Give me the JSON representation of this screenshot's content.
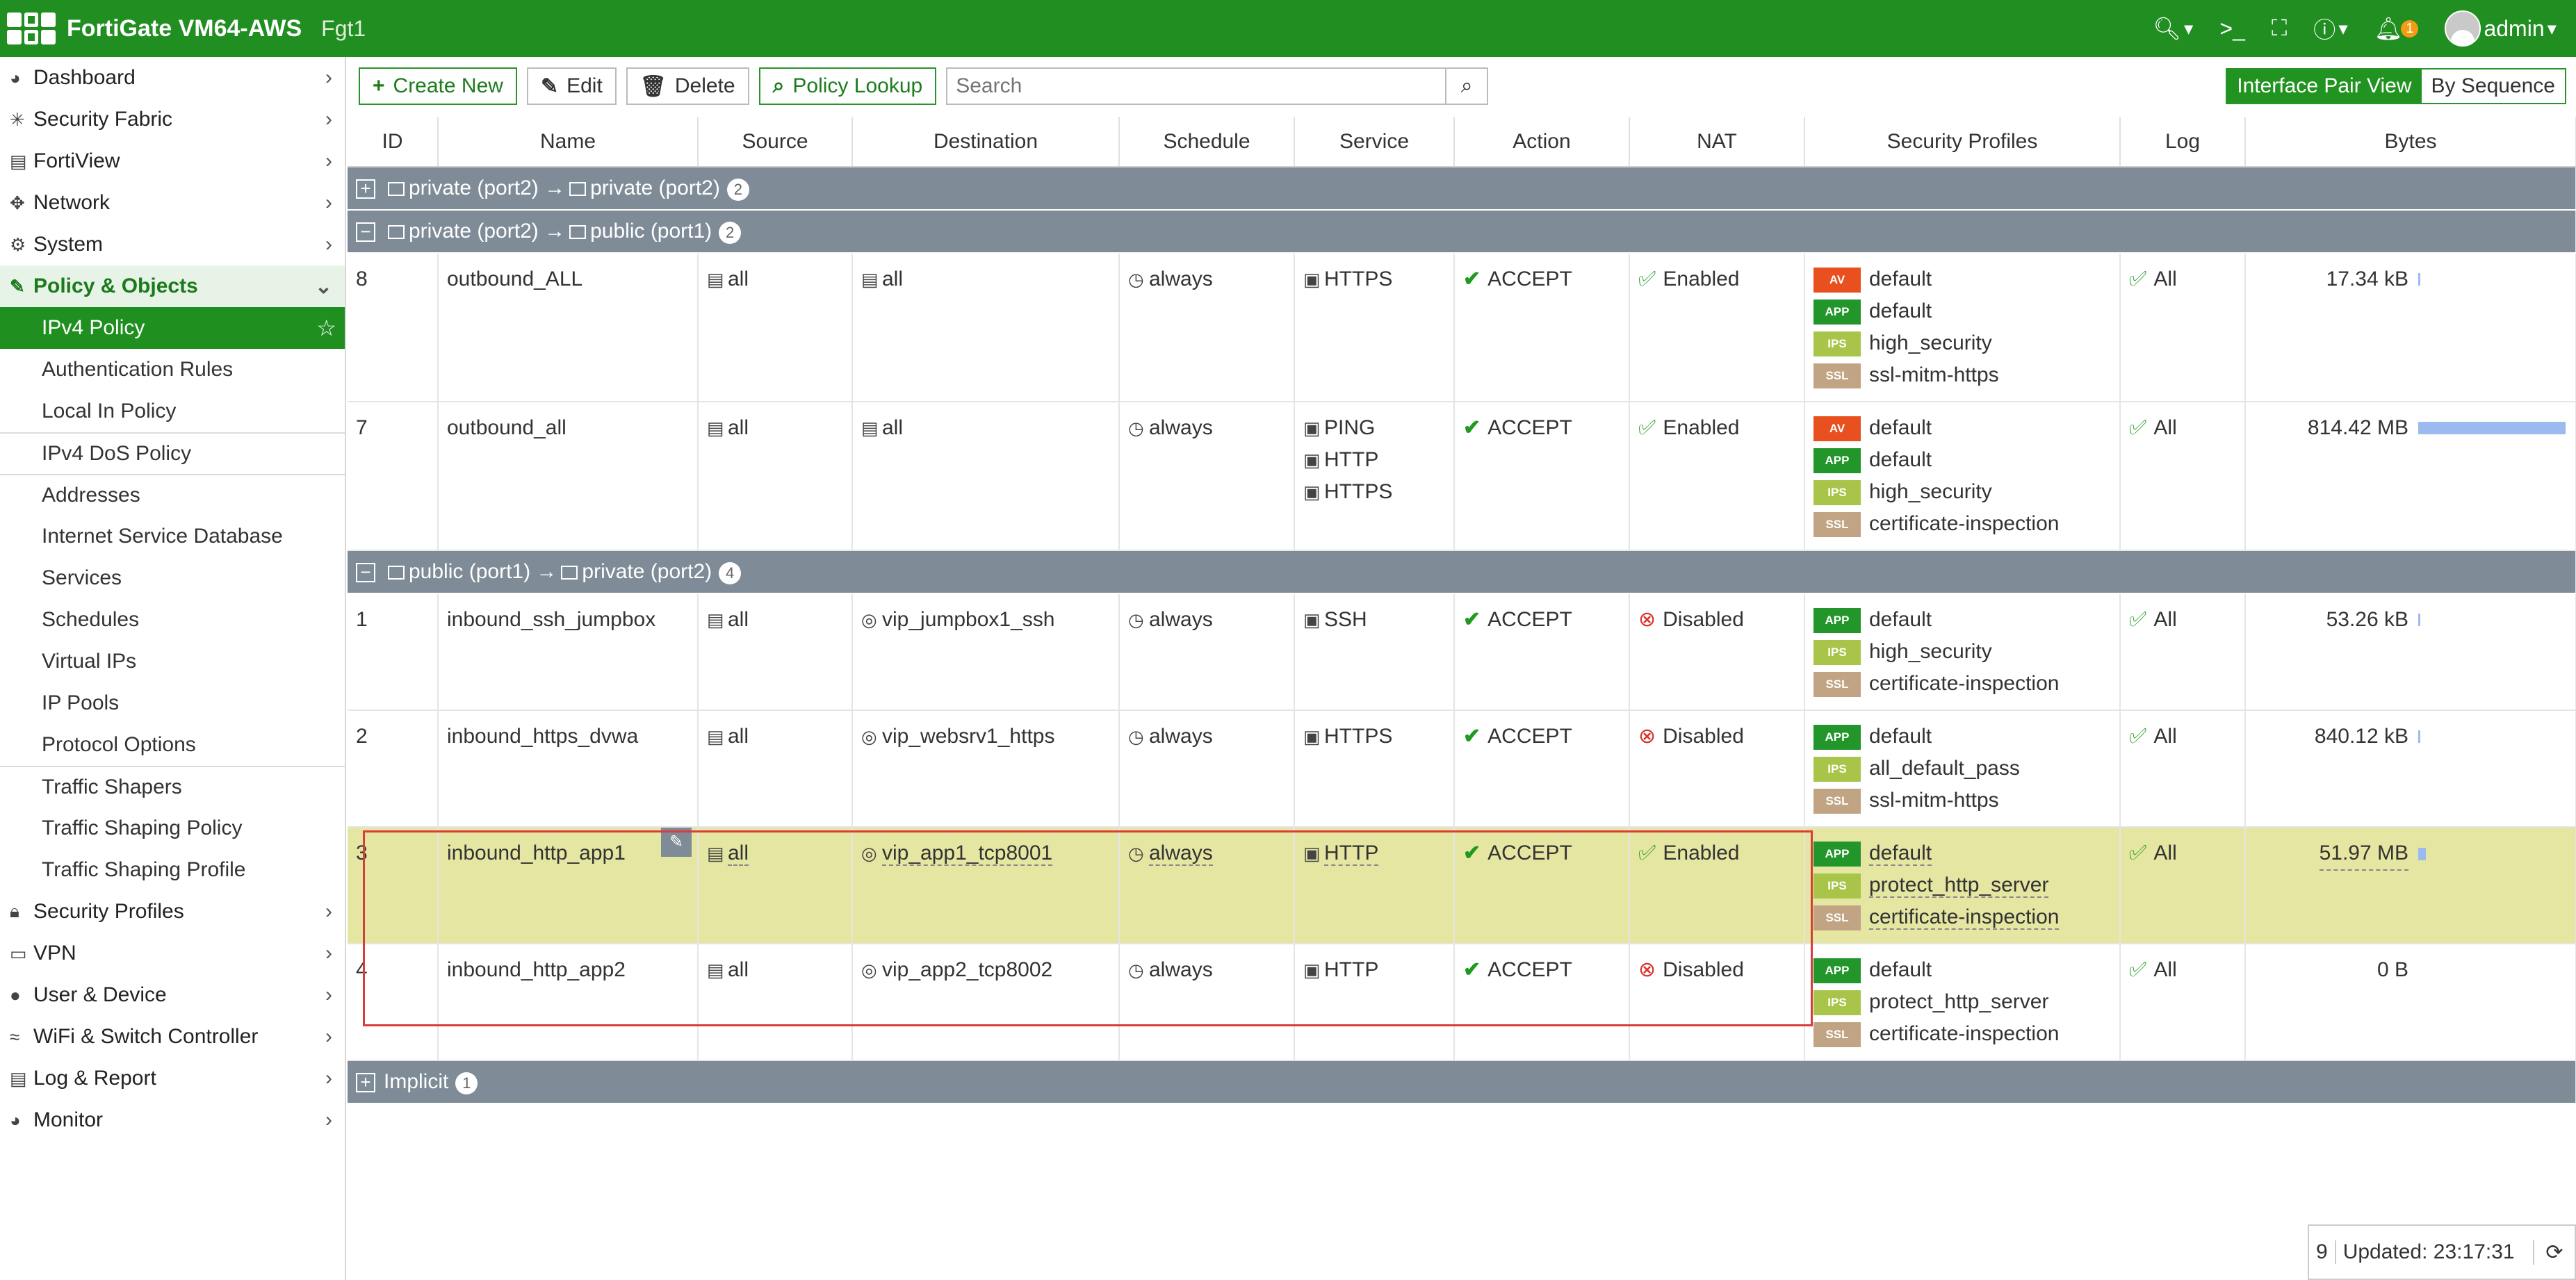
{
  "header": {
    "app_title": "FortiGate VM64-AWS",
    "host": "Fgt1",
    "user": "admin",
    "notification_count": "1",
    "icons": [
      "search-icon",
      "cli-icon",
      "fullscreen-icon",
      "help-icon",
      "bell-icon",
      "user-icon"
    ]
  },
  "sidebar": {
    "items": [
      {
        "label": "Dashboard",
        "icon": "dashboard-icon"
      },
      {
        "label": "Security Fabric",
        "icon": "fabric-icon"
      },
      {
        "label": "FortiView",
        "icon": "chart-icon"
      },
      {
        "label": "Network",
        "icon": "network-icon"
      },
      {
        "label": "System",
        "icon": "gear-icon"
      },
      {
        "label": "Policy & Objects",
        "icon": "policy-icon"
      }
    ],
    "sub_items": [
      "IPv4 Policy",
      "Authentication Rules",
      "Local In Policy",
      "IPv4 DoS Policy",
      "Addresses",
      "Internet Service Database",
      "Services",
      "Schedules",
      "Virtual IPs",
      "IP Pools",
      "Protocol Options",
      "Traffic Shapers",
      "Traffic Shaping Policy",
      "Traffic Shaping Profile"
    ],
    "bottom_items": [
      {
        "label": "Security Profiles",
        "icon": "lock-icon"
      },
      {
        "label": "VPN",
        "icon": "laptop-icon"
      },
      {
        "label": "User & Device",
        "icon": "person-icon"
      },
      {
        "label": "WiFi & Switch Controller",
        "icon": "wifi-icon"
      },
      {
        "label": "Log & Report",
        "icon": "report-icon"
      },
      {
        "label": "Monitor",
        "icon": "monitor-icon"
      }
    ]
  },
  "toolbar": {
    "create_new": "Create New",
    "edit": "Edit",
    "delete": "Delete",
    "policy_lookup": "Policy Lookup",
    "search_placeholder": "Search",
    "interface_pair_view": "Interface Pair View",
    "by_sequence": "By Sequence"
  },
  "table": {
    "columns": [
      "ID",
      "Name",
      "Source",
      "Destination",
      "Schedule",
      "Service",
      "Action",
      "NAT",
      "Security Profiles",
      "Log",
      "Bytes"
    ],
    "groups": [
      {
        "sign": "+",
        "from": "private (port2)",
        "to": "private (port2)",
        "count": "2"
      },
      {
        "sign": "−",
        "from": "private (port2)",
        "to": "public (port1)",
        "count": "2"
      },
      {
        "sign": "−",
        "from": "public (port1)",
        "to": "private (port2)",
        "count": "4"
      },
      {
        "sign": "+",
        "label": "Implicit",
        "count": "1"
      }
    ],
    "rows": [
      {
        "id": "8",
        "name": "outbound_ALL",
        "src": "all",
        "dst": "all",
        "schedule": "always",
        "services": [
          "HTTPS"
        ],
        "action": "ACCEPT",
        "nat": "Enabled",
        "profiles": [
          [
            "AV",
            "default"
          ],
          [
            "APP",
            "default"
          ],
          [
            "IPS",
            "high_security"
          ],
          [
            "SSL",
            "ssl-mitm-https"
          ]
        ],
        "log": "All",
        "bytes": "17.34 kB",
        "bytes_fraction": 0.01
      },
      {
        "id": "7",
        "name": "outbound_all",
        "src": "all",
        "dst": "all",
        "schedule": "always",
        "services": [
          "PING",
          "HTTP",
          "HTTPS"
        ],
        "action": "ACCEPT",
        "nat": "Enabled",
        "profiles": [
          [
            "AV",
            "default"
          ],
          [
            "APP",
            "default"
          ],
          [
            "IPS",
            "high_security"
          ],
          [
            "SSL",
            "certificate-inspection"
          ]
        ],
        "log": "All",
        "bytes": "814.42 MB",
        "bytes_fraction": 1.0
      },
      {
        "id": "1",
        "name": "inbound_ssh_jumpbox",
        "src": "all",
        "dst": "vip_jumpbox1_ssh",
        "schedule": "always",
        "services": [
          "SSH"
        ],
        "action": "ACCEPT",
        "nat": "Disabled",
        "profiles": [
          [
            "APP",
            "default"
          ],
          [
            "IPS",
            "high_security"
          ],
          [
            "SSL",
            "certificate-inspection"
          ]
        ],
        "log": "All",
        "bytes": "53.26 kB",
        "bytes_fraction": 0.01
      },
      {
        "id": "2",
        "name": "inbound_https_dvwa",
        "src": "all",
        "dst": "vip_websrv1_https",
        "schedule": "always",
        "services": [
          "HTTPS"
        ],
        "action": "ACCEPT",
        "nat": "Disabled",
        "profiles": [
          [
            "APP",
            "default"
          ],
          [
            "IPS",
            "all_default_pass"
          ],
          [
            "SSL",
            "ssl-mitm-https"
          ]
        ],
        "log": "All",
        "bytes": "840.12 kB",
        "bytes_fraction": 0.01
      },
      {
        "id": "3",
        "name": "inbound_http_app1",
        "src": "all",
        "dst": "vip_app1_tcp8001",
        "schedule": "always",
        "services": [
          "HTTP"
        ],
        "action": "ACCEPT",
        "nat": "Enabled",
        "profiles": [
          [
            "APP",
            "default"
          ],
          [
            "IPS",
            "protect_http_server"
          ],
          [
            "SSL",
            "certificate-inspection"
          ]
        ],
        "log": "All",
        "bytes": "51.97 MB",
        "bytes_fraction": 0.06
      },
      {
        "id": "4",
        "name": "inbound_http_app2",
        "src": "all",
        "dst": "vip_app2_tcp8002",
        "schedule": "always",
        "services": [
          "HTTP"
        ],
        "action": "ACCEPT",
        "nat": "Disabled",
        "profiles": [
          [
            "APP",
            "default"
          ],
          [
            "IPS",
            "protect_http_server"
          ],
          [
            "SSL",
            "certificate-inspection"
          ]
        ],
        "log": "All",
        "bytes": "0 B",
        "bytes_fraction": 0
      }
    ]
  },
  "status": {
    "count": "9",
    "updated": "Updated: 23:17:31"
  },
  "colors": {
    "brand_green": "#218e21",
    "group_row": "#7f8c97",
    "highlight_row": "#e5e6a2",
    "selection_border": "#d83c3c",
    "bytes_bar": "#9cb9f0"
  }
}
